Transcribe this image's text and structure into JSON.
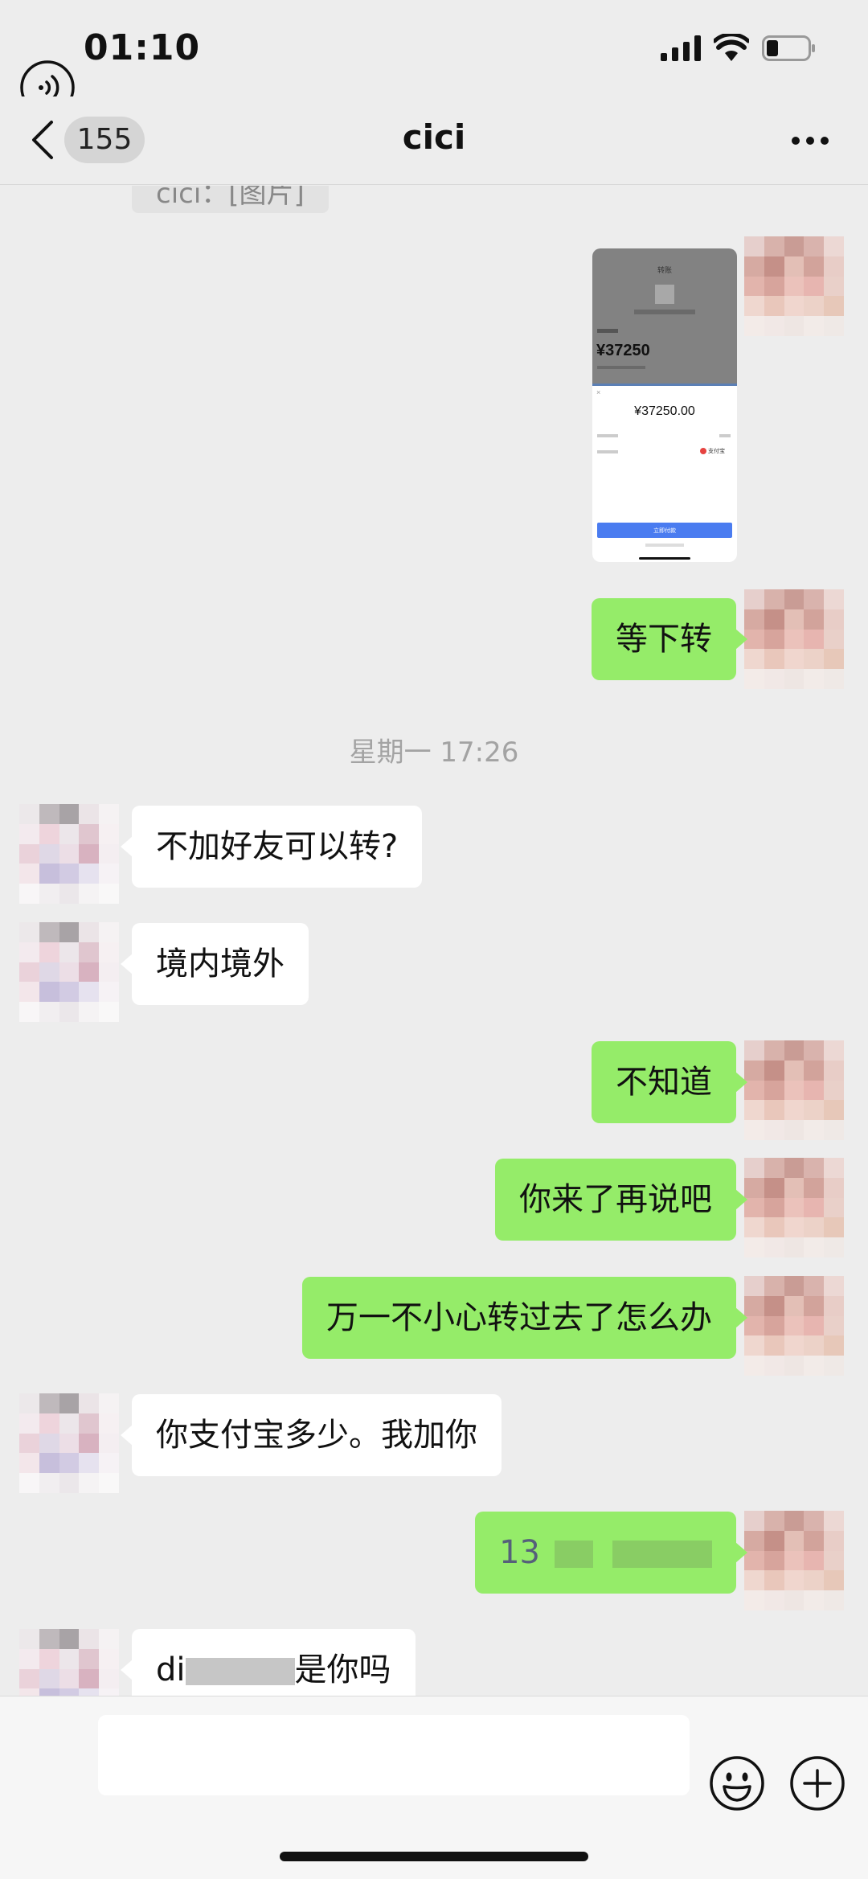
{
  "status_bar": {
    "time": "01:10"
  },
  "nav": {
    "unread_count": "155",
    "title": "cici"
  },
  "messages": {
    "quote_text": "cici：[图片]",
    "transfer_screenshot": {
      "header": "转账",
      "amount_top": "¥37250",
      "amount_sheet": "¥37250.00",
      "method_label": "支付宝",
      "pay_button": "立即付款"
    },
    "m1": "等下转",
    "timestamp": "星期一 17:26",
    "m2": "不加好友可以转?",
    "m3": "境内境外",
    "m4": "不知道",
    "m5": "你来了再说吧",
    "m6": "万一不小心转过去了怎么办",
    "m7": "你支付宝多少。我加你",
    "m8_prefix": "13",
    "m9_prefix": "di",
    "m9_suffix": "是你吗"
  },
  "input": {
    "placeholder": ""
  },
  "colors": {
    "outgoing_bubble": "#95ec69",
    "incoming_bubble": "#ffffff",
    "background": "#ededed"
  }
}
